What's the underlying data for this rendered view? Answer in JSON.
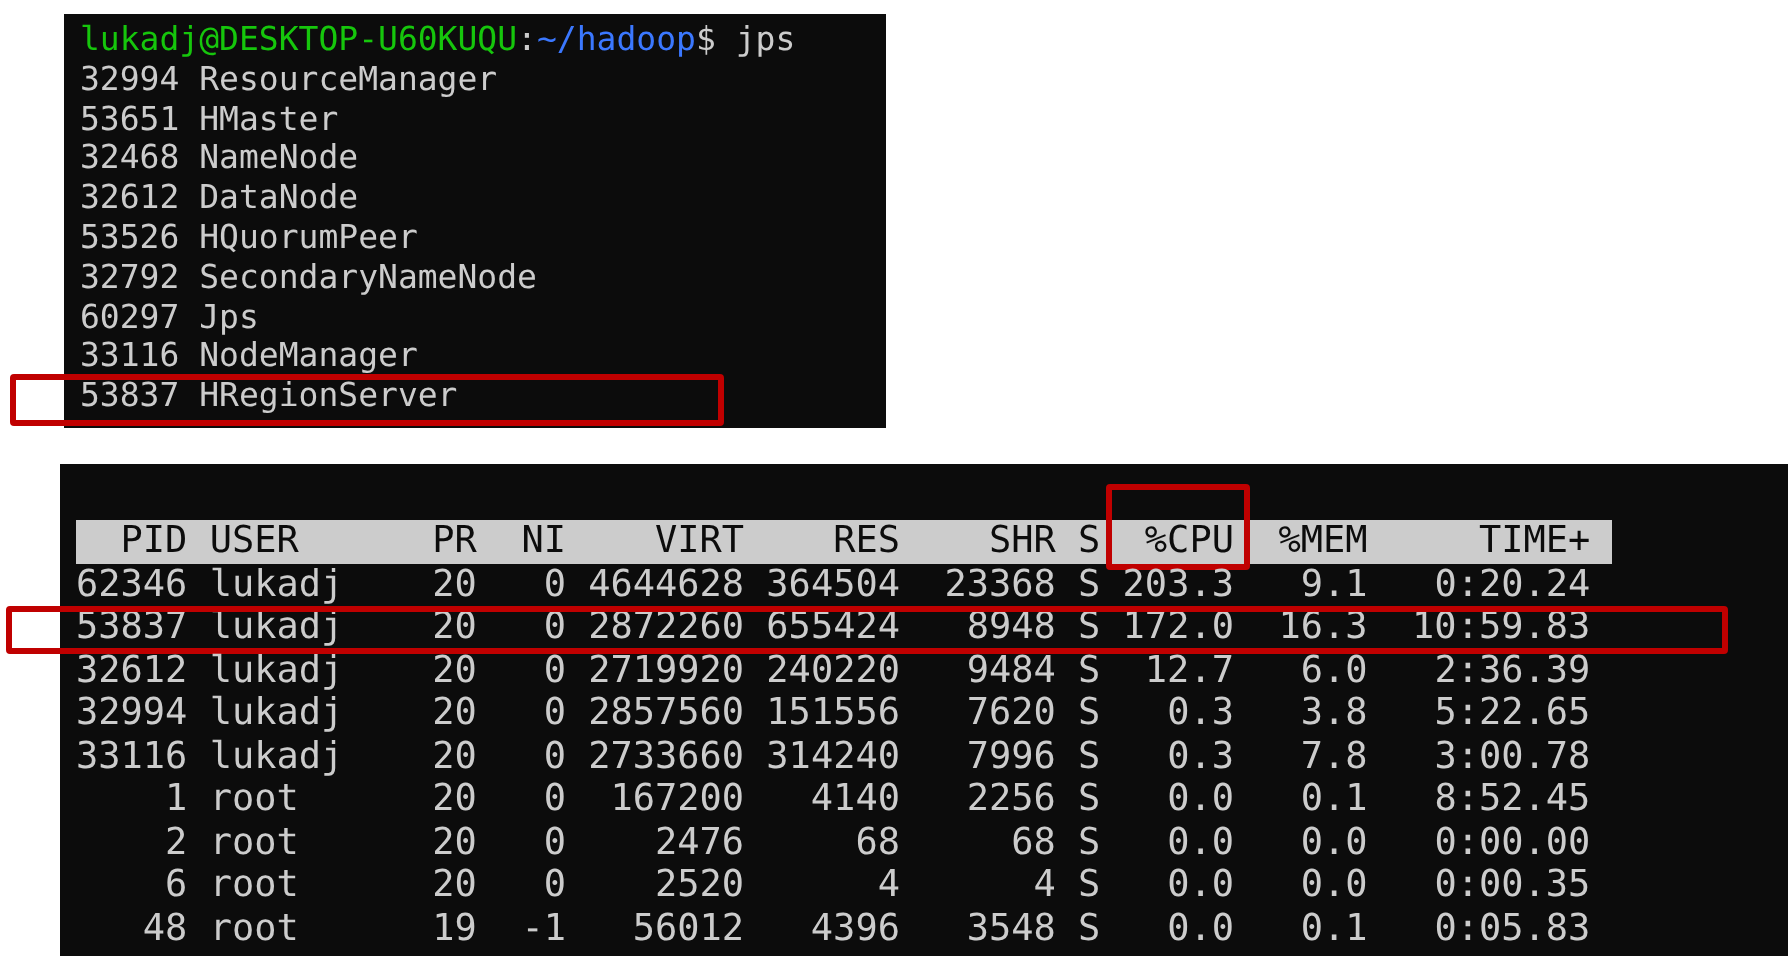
{
  "jps_terminal": {
    "prompt": [
      {
        "text": "lukadj@DESKTOP-U60KUQU",
        "kind": "user"
      },
      {
        "text": ":",
        "kind": "plain"
      },
      {
        "text": "~/hadoop",
        "kind": "path"
      },
      {
        "text": "$ jps",
        "kind": "plain"
      }
    ],
    "lines": [
      {
        "pid": "32994",
        "name": "ResourceManager",
        "highlighted": false
      },
      {
        "pid": "53651",
        "name": "HMaster",
        "highlighted": false
      },
      {
        "pid": "32468",
        "name": "NameNode",
        "highlighted": false
      },
      {
        "pid": "32612",
        "name": "DataNode",
        "highlighted": false
      },
      {
        "pid": "53526",
        "name": "HQuorumPeer",
        "highlighted": false
      },
      {
        "pid": "32792",
        "name": "SecondaryNameNode",
        "highlighted": false
      },
      {
        "pid": "60297",
        "name": "Jps",
        "highlighted": false
      },
      {
        "pid": "33116",
        "name": "NodeManager",
        "highlighted": false
      },
      {
        "pid": "53837",
        "name": "HRegionServer",
        "highlighted": true
      }
    ]
  },
  "top_terminal": {
    "columns": [
      {
        "label": "PID",
        "highlighted": false
      },
      {
        "label": "USER",
        "highlighted": false
      },
      {
        "label": "PR",
        "highlighted": false
      },
      {
        "label": "NI",
        "highlighted": false
      },
      {
        "label": "VIRT",
        "highlighted": false
      },
      {
        "label": "RES",
        "highlighted": false
      },
      {
        "label": "SHR",
        "highlighted": false
      },
      {
        "label": "S",
        "highlighted": false
      },
      {
        "label": "%CPU",
        "highlighted": true
      },
      {
        "label": "%MEM",
        "highlighted": false
      },
      {
        "label": "TIME+",
        "highlighted": false
      }
    ],
    "rows": [
      {
        "cells": [
          "62346",
          "lukadj",
          "20",
          "0",
          "4644628",
          "364504",
          "23368",
          "S",
          "203.3",
          "9.1",
          "0:20.24"
        ],
        "highlighted": false
      },
      {
        "cells": [
          "53837",
          "lukadj",
          "20",
          "0",
          "2872260",
          "655424",
          "8948",
          "S",
          "172.0",
          "16.3",
          "10:59.83"
        ],
        "highlighted": true
      },
      {
        "cells": [
          "32612",
          "lukadj",
          "20",
          "0",
          "2719920",
          "240220",
          "9484",
          "S",
          "12.7",
          "6.0",
          "2:36.39"
        ],
        "highlighted": false
      },
      {
        "cells": [
          "32994",
          "lukadj",
          "20",
          "0",
          "2857560",
          "151556",
          "7620",
          "S",
          "0.3",
          "3.8",
          "5:22.65"
        ],
        "highlighted": false
      },
      {
        "cells": [
          "33116",
          "lukadj",
          "20",
          "0",
          "2733660",
          "314240",
          "7996",
          "S",
          "0.3",
          "7.8",
          "3:00.78"
        ],
        "highlighted": false
      },
      {
        "cells": [
          "1",
          "root",
          "20",
          "0",
          "167200",
          "4140",
          "2256",
          "S",
          "0.0",
          "0.1",
          "8:52.45"
        ],
        "highlighted": false
      },
      {
        "cells": [
          "2",
          "root",
          "20",
          "0",
          "2476",
          "68",
          "68",
          "S",
          "0.0",
          "0.0",
          "0:00.00"
        ],
        "highlighted": false
      },
      {
        "cells": [
          "6",
          "root",
          "20",
          "0",
          "2520",
          "4",
          "4",
          "S",
          "0.0",
          "0.0",
          "0:00.35"
        ],
        "highlighted": false
      },
      {
        "cells": [
          "48",
          "root",
          "19",
          "-1",
          "56012",
          "4396",
          "3548",
          "S",
          "0.0",
          "0.1",
          "0:05.83"
        ],
        "highlighted": false
      }
    ]
  }
}
